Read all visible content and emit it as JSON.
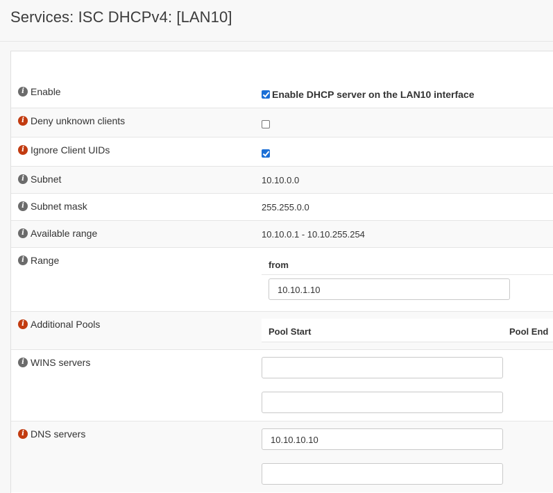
{
  "page": {
    "title": "Services: ISC DHCPv4: [LAN10]"
  },
  "rows": {
    "enable": {
      "label": "Enable",
      "checkbox_checked": "true",
      "checkbox_label": "Enable DHCP server on the LAN10 interface"
    },
    "deny_unknown": {
      "label": "Deny unknown clients",
      "checkbox_checked": "false"
    },
    "ignore_uids": {
      "label": "Ignore Client UIDs",
      "checkbox_checked": "true"
    },
    "subnet": {
      "label": "Subnet",
      "value": "10.10.0.0"
    },
    "subnet_mask": {
      "label": "Subnet mask",
      "value": "255.255.0.0"
    },
    "available_range": {
      "label": "Available range",
      "value": "10.10.0.1 - 10.10.255.254"
    },
    "range": {
      "label": "Range",
      "from_header": "from",
      "from_value": "10.10.1.10"
    },
    "additional_pools": {
      "label": "Additional Pools",
      "pool_start_header": "Pool Start",
      "pool_end_header": "Pool End"
    },
    "wins": {
      "label": "WINS servers",
      "server1": "",
      "server2": ""
    },
    "dns": {
      "label": "DNS servers",
      "server1": "10.10.10.10",
      "server2": ""
    }
  },
  "icon_colors": {
    "info_grey": "#6b6b6b",
    "info_red": "#c23b10",
    "checkbox_checked": "#1b6fd6"
  }
}
